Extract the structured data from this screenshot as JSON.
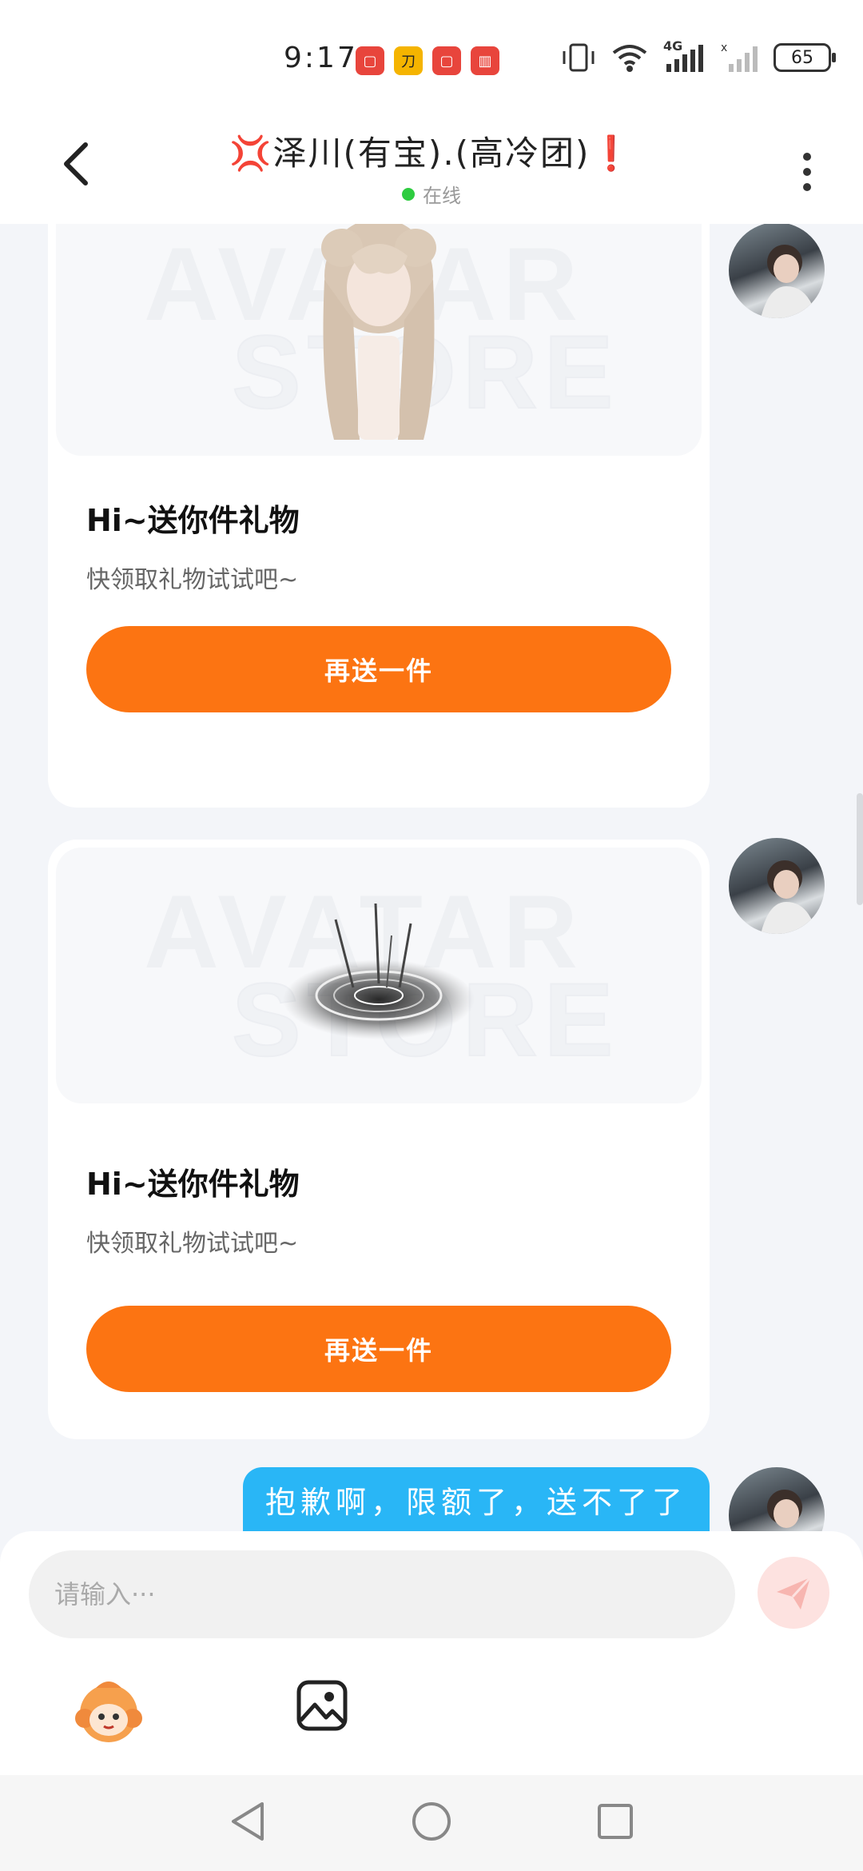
{
  "status_bar": {
    "time": "9:17",
    "network": "4G",
    "battery": "65",
    "app_icons": [
      "huawei-store-icon",
      "game-app-icon",
      "huawei-store-icon",
      "reader-app-icon"
    ]
  },
  "header": {
    "title_prefix": "💢",
    "title": "泽川(有宝).(高冷团)",
    "title_suffix": "❗",
    "status": "在线"
  },
  "messages": [
    {
      "type": "gift",
      "title": "Hi~送你件礼物",
      "subtitle": "快领取礼物试试吧~",
      "button_label": "再送一件",
      "watermark_line1": "AVATAR",
      "watermark_line2": "STORE"
    },
    {
      "type": "gift",
      "title": "Hi~送你件礼物",
      "subtitle": "快领取礼物试试吧~",
      "button_label": "再送一件",
      "watermark_line1": "AVATAR",
      "watermark_line2": "STORE"
    },
    {
      "type": "text",
      "text": "抱歉啊，限额了，送不了了"
    }
  ],
  "input": {
    "placeholder": "请输入···"
  },
  "colors": {
    "accent": "#fc7412",
    "bubble": "#29b6f6",
    "online": "#2ecc40",
    "background": "#f3f5f9"
  }
}
